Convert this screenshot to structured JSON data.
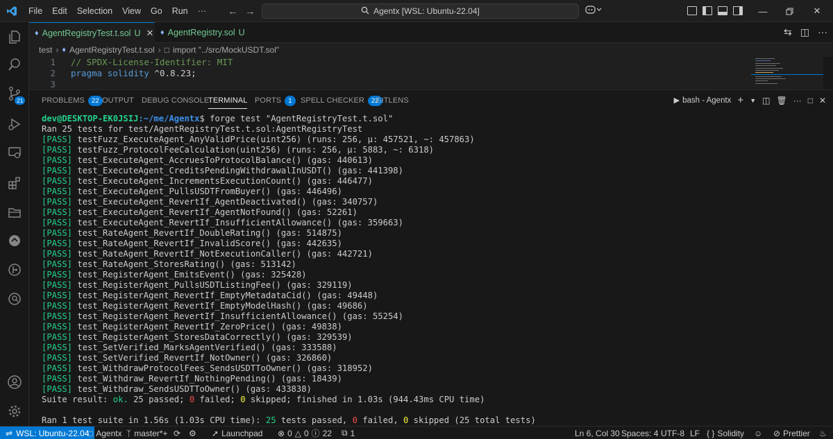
{
  "menu": [
    "File",
    "Edit",
    "Selection",
    "View",
    "Go",
    "Run",
    "···"
  ],
  "search": {
    "text": "Agentx [WSL: Ubuntu-22.04]"
  },
  "tabs": [
    {
      "name": "AgentRegistryTest.t.sol",
      "status": "U",
      "active": true
    },
    {
      "name": "AgentRegistry.sol",
      "status": "U",
      "active": false
    }
  ],
  "breadcrumb": {
    "folder": "test",
    "file": "AgentRegistryTest.t.sol",
    "symbol": "import \"../src/MockUSDT.sol\""
  },
  "editor": {
    "lines": [
      {
        "num": "1",
        "comment": "// SPDX-License-Identifier: MIT"
      },
      {
        "num": "2",
        "kw1": "pragma",
        "kw2": "solidity",
        "rest": " ^0.8.23;"
      },
      {
        "num": "3"
      }
    ]
  },
  "activity": {
    "scm_badge": "21"
  },
  "panel": {
    "tabs": [
      {
        "label": "PROBLEMS",
        "badge": "22"
      },
      {
        "label": "OUTPUT"
      },
      {
        "label": "DEBUG CONSOLE"
      },
      {
        "label": "TERMINAL",
        "active": true
      },
      {
        "label": "PORTS",
        "badge": "1"
      },
      {
        "label": "SPELL CHECKER",
        "badge": "22"
      },
      {
        "label": "GITLENS"
      }
    ],
    "terminal_name": "bash - Agentx"
  },
  "terminal": {
    "prompt_user": "dev@DESKTOP-EK0JSIJ",
    "prompt_path": ":~/me/Agentx",
    "prompt_cmd": "$ forge test \"AgentRegistryTest.t.sol\"",
    "run_line": "Ran 25 tests for test/AgentRegistryTest.t.sol:AgentRegistryTest",
    "pass_tag": "[PASS]",
    "results": [
      "testFuzz_ExecuteAgent_AnyValidPrice(uint256) (runs: 256, μ: 457521, ~: 457863)",
      "testFuzz_ProtocolFeeCalculation(uint256) (runs: 256, μ: 5883, ~: 6318)",
      "test_ExecuteAgent_AccruesToProtocolBalance() (gas: 440613)",
      "test_ExecuteAgent_CreditsPendingWithdrawalInUSDT() (gas: 441398)",
      "test_ExecuteAgent_IncrementsExecutionCount() (gas: 446477)",
      "test_ExecuteAgent_PullsUSDTFromBuyer() (gas: 446496)",
      "test_ExecuteAgent_RevertIf_AgentDeactivated() (gas: 340757)",
      "test_ExecuteAgent_RevertIf_AgentNotFound() (gas: 52261)",
      "test_ExecuteAgent_RevertIf_InsufficientAllowance() (gas: 359663)",
      "test_RateAgent_RevertIf_DoubleRating() (gas: 514875)",
      "test_RateAgent_RevertIf_InvalidScore() (gas: 442635)",
      "test_RateAgent_RevertIf_NotExecutionCaller() (gas: 442721)",
      "test_RateAgent_StoresRating() (gas: 513142)",
      "test_RegisterAgent_EmitsEvent() (gas: 325428)",
      "test_RegisterAgent_PullsUSDTListingFee() (gas: 329119)",
      "test_RegisterAgent_RevertIf_EmptyMetadataCid() (gas: 49448)",
      "test_RegisterAgent_RevertIf_EmptyModelHash() (gas: 49686)",
      "test_RegisterAgent_RevertIf_InsufficientAllowance() (gas: 55254)",
      "test_RegisterAgent_RevertIf_ZeroPrice() (gas: 49838)",
      "test_RegisterAgent_StoresDataCorrectly() (gas: 329539)",
      "test_SetVerified_MarksAgentVerified() (gas: 333588)",
      "test_SetVerified_RevertIf_NotOwner() (gas: 326860)",
      "test_WithdrawProtocolFees_SendsUSDTToOwner() (gas: 318952)",
      "test_Withdraw_RevertIf_NothingPending() (gas: 18439)",
      "test_Withdraw_SendsUSDTToOwner() (gas: 433838)"
    ],
    "suite_a": "Suite result: ",
    "suite_ok": "ok.",
    "suite_passed": " 25",
    "suite_b": " passed; ",
    "suite_failed": "0",
    "suite_c": " failed; ",
    "suite_skipped": "0",
    "suite_d": " skipped; finished in 1.03s (944.43ms CPU time)",
    "final_a": "Ran 1 test suite in 1.56s (1.03s CPU time): ",
    "final_passed": "25",
    "final_b": " tests passed, ",
    "final_failed": "0",
    "final_c": " failed, ",
    "final_skipped": "0",
    "final_d": " skipped (25 total tests)"
  },
  "statusbar": {
    "remote": "WSL: Ubuntu-22.04",
    "folder": "Agentx",
    "branch": "master*+",
    "launchpad": "Launchpad",
    "errors": "0",
    "warnings": "0",
    "infos": "22",
    "ports": "1",
    "position": "Ln 6, Col 30",
    "spaces": "Spaces: 4",
    "encoding": "UTF-8",
    "eol": "LF",
    "language": "Solidity",
    "prettier": "Prettier"
  },
  "colors": {
    "accent": "#0078d4",
    "pass": "#23d18b",
    "path": "#3b8eea"
  }
}
